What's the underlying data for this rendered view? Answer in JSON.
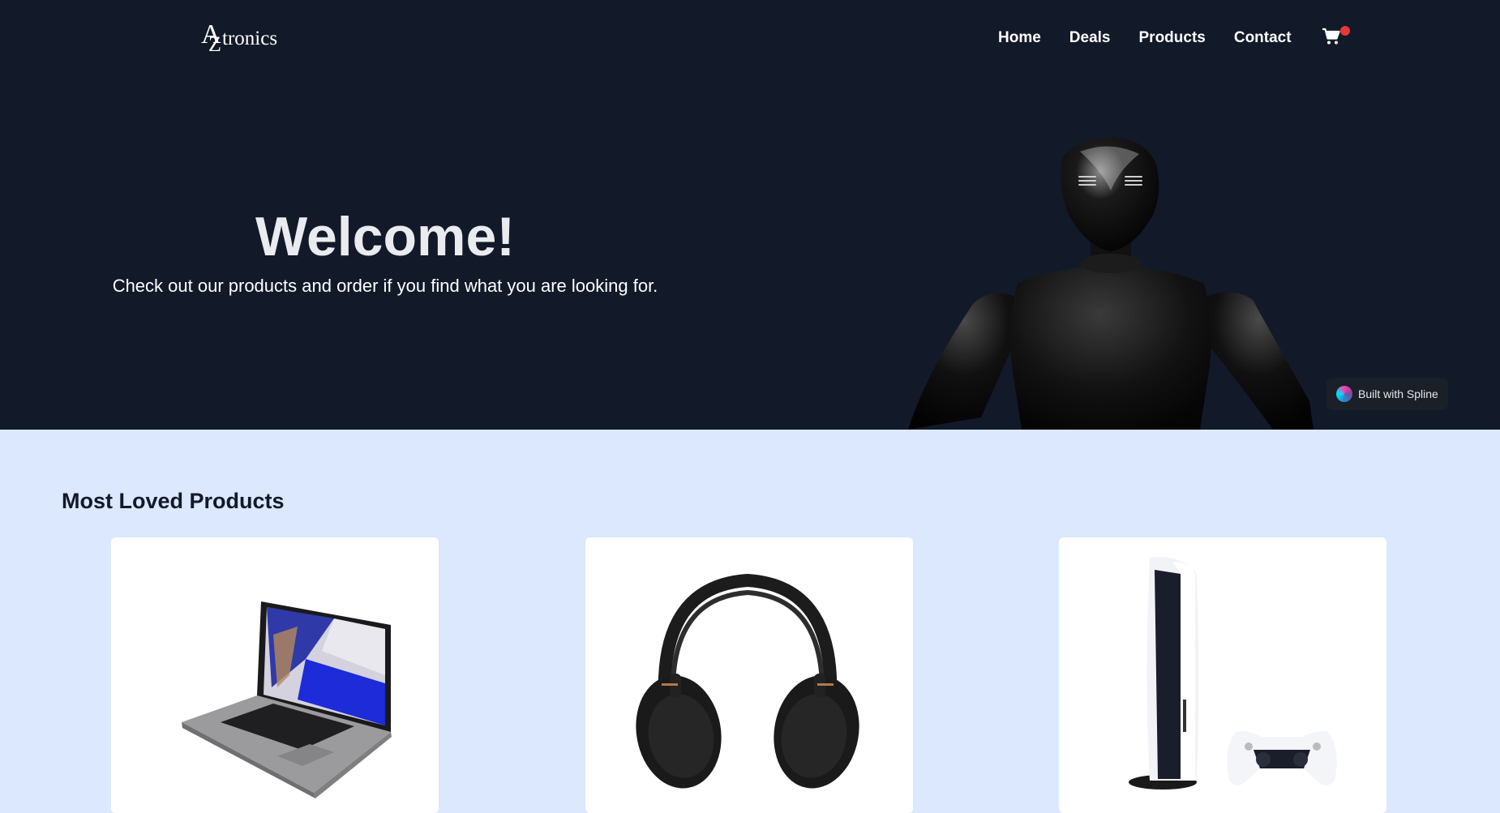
{
  "header": {
    "logo_mark_a": "A",
    "logo_mark_z": "Z",
    "logo_text": "tronics",
    "nav": [
      "Home",
      "Deals",
      "Products",
      "Contact"
    ],
    "cart_icon": "shopping-cart-icon"
  },
  "hero": {
    "title": "Welcome!",
    "subtitle": "Check out our products and order if you find what you are looking for.",
    "badge_label": "Built with Spline"
  },
  "products_section": {
    "title": "Most Loved Products",
    "cards": [
      {
        "image": "laptop"
      },
      {
        "image": "headphones"
      },
      {
        "image": "game-console"
      }
    ]
  },
  "colors": {
    "hero_bg": "#121929",
    "page_bg": "#dbe8fe",
    "badge_red": "#e53935"
  }
}
